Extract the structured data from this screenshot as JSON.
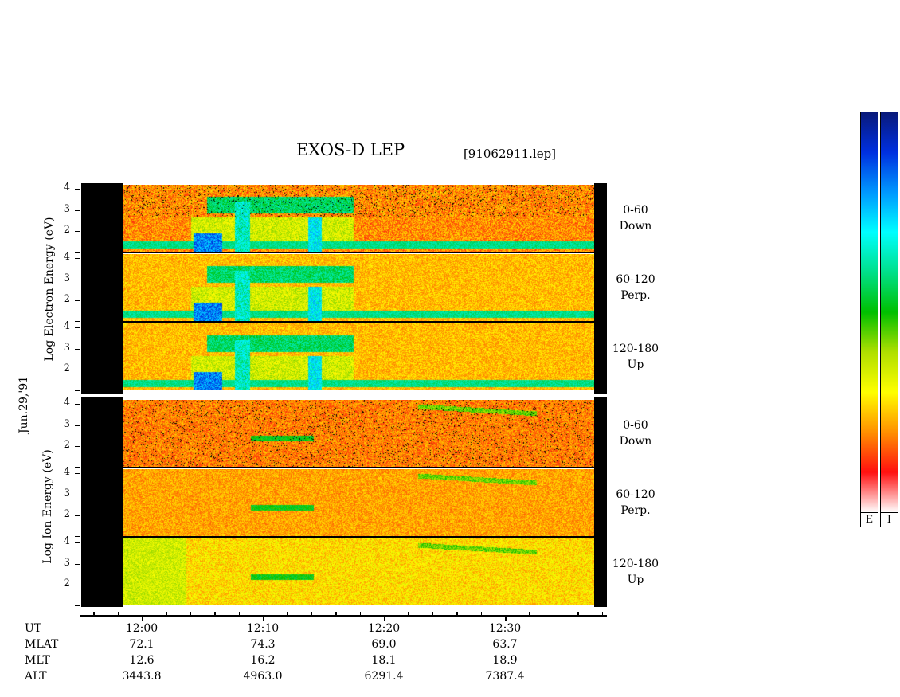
{
  "title": "EXOS-D LEP",
  "file_tag": "[91062911.lep]",
  "date_label": "Jun.29,'91",
  "electron_label": "Log  Electron  Energy (eV)",
  "ion_label": "Log  Ion  Energy  (eV)",
  "colorbars": {
    "electron_label": "E",
    "ion_label": "I",
    "gradient": [
      "#0a1a7a",
      "#0030e0",
      "#0098ff",
      "#00ffff",
      "#00e08a",
      "#00c000",
      "#b0e000",
      "#ffff00",
      "#ff9000",
      "#ff1010",
      "#ffffff"
    ]
  },
  "chart_data": {
    "type": "heatmap",
    "y_axis": {
      "label": "Log Energy (eV)",
      "ticks": [
        "4",
        "3",
        "2"
      ],
      "range": [
        1,
        4.2
      ]
    },
    "x_axis": {
      "label": "UT",
      "ticks": [
        "12:00",
        "12:10",
        "12:20",
        "12:30"
      ],
      "minutes": [
        0,
        10,
        20,
        30
      ]
    },
    "electron_panels": [
      {
        "name": "Electron",
        "pitch": "0-60",
        "dir": "Down"
      },
      {
        "name": "Electron",
        "pitch": "60-120",
        "dir": "Perp."
      },
      {
        "name": "Electron",
        "pitch": "120-180",
        "dir": "Up"
      }
    ],
    "ion_panels": [
      {
        "name": "Ion",
        "pitch": "0-60",
        "dir": "Down"
      },
      {
        "name": "Ion",
        "pitch": "60-120",
        "dir": "Perp."
      },
      {
        "name": "Ion",
        "pitch": "120-180",
        "dir": "Up"
      }
    ],
    "orbit_rows": [
      {
        "name": "UT",
        "values": [
          "12:00",
          "12:10",
          "12:20",
          "12:30"
        ]
      },
      {
        "name": "MLAT",
        "values": [
          "72.1",
          "74.3",
          "69.0",
          "63.7"
        ]
      },
      {
        "name": "MLT",
        "values": [
          "12.6",
          "16.2",
          "18.1",
          "18.9"
        ]
      },
      {
        "name": "ALT",
        "values": [
          "3443.8",
          "4963.0",
          "6291.4",
          "7387.4"
        ]
      }
    ]
  }
}
